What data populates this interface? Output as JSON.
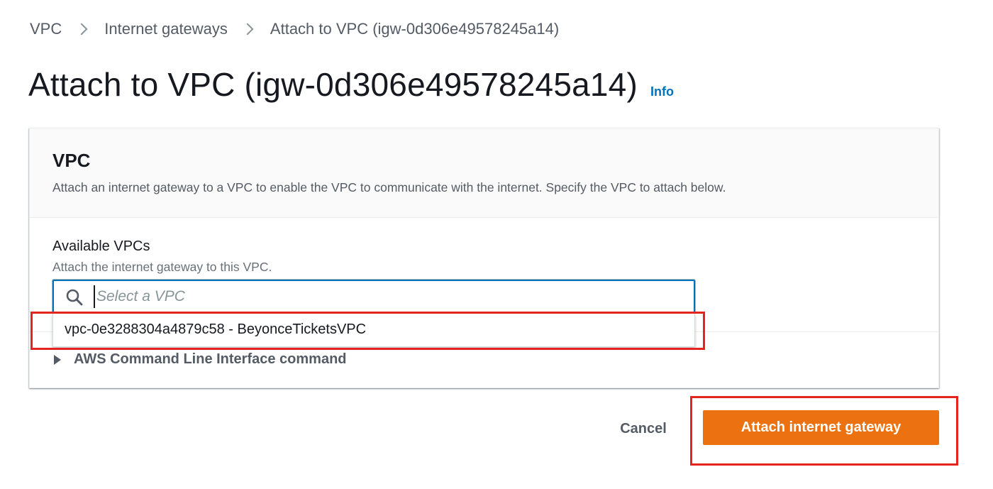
{
  "breadcrumb": {
    "items": [
      "VPC",
      "Internet gateways",
      "Attach to VPC (igw-0d306e49578245a14)"
    ]
  },
  "header": {
    "title": "Attach to VPC (igw-0d306e49578245a14)",
    "info_label": "Info"
  },
  "panel": {
    "title": "VPC",
    "description": "Attach an internet gateway to a VPC to enable the VPC to communicate with the internet. Specify the VPC to attach below.",
    "field": {
      "label": "Available VPCs",
      "description": "Attach the internet gateway to this VPC.",
      "placeholder": "Select a VPC",
      "value": "",
      "options": [
        "vpc-0e3288304a4879c58 - BeyonceTicketsVPC"
      ]
    },
    "cli_expander_label": "AWS Command Line Interface command"
  },
  "actions": {
    "cancel_label": "Cancel",
    "submit_label": "Attach internet gateway"
  },
  "icons": {
    "breadcrumb_separator": "chevron-right-icon",
    "search": "search-icon",
    "expander": "caret-right-icon"
  },
  "colors": {
    "link": "#0073bb",
    "primary_button": "#ec7211",
    "annotation_highlight": "#e5231f",
    "focus_border": "#0073bb"
  }
}
